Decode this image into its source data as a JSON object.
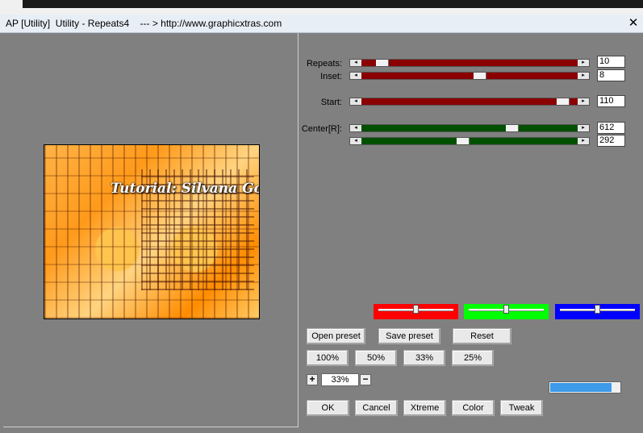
{
  "window": {
    "title": "AP [Utility]  Utility - Repeats4    --- > http://www.graphicxtras.com",
    "close_glyph": "✕"
  },
  "preview": {
    "caption": "Tutorial: Silvana Gomes"
  },
  "params": {
    "repeats": {
      "label": "Repeats:",
      "value": "10",
      "position": 0.07
    },
    "inset": {
      "label": "Inset:",
      "value": "8",
      "position": 0.55
    },
    "start": {
      "label": "Start:",
      "value": "110",
      "position": 0.96
    },
    "center_x": {
      "label": "Center[R]:",
      "value": "612",
      "position": 0.71
    },
    "center_y": {
      "value": "292",
      "position": 0.47
    }
  },
  "color_sliders": [
    {
      "name": "red",
      "color": "#ff0000",
      "position": 0.5
    },
    {
      "name": "green",
      "color": "#00ff00",
      "position": 0.5
    },
    {
      "name": "blue",
      "color": "#0000ff",
      "position": 0.5
    }
  ],
  "buttons": {
    "open_preset": "Open preset",
    "save_preset": "Save preset",
    "reset": "Reset",
    "zoom_100": "100%",
    "zoom_50": "50%",
    "zoom_33": "33%",
    "zoom_25": "25%",
    "ok": "OK",
    "cancel": "Cancel",
    "xtreme": "Xtreme",
    "color": "Color",
    "tweak": "Tweak"
  },
  "zoom": {
    "plus": "+",
    "value": "33%",
    "minus": "−"
  },
  "progress": {
    "fraction": 0.88,
    "color": "#3d9be9"
  }
}
